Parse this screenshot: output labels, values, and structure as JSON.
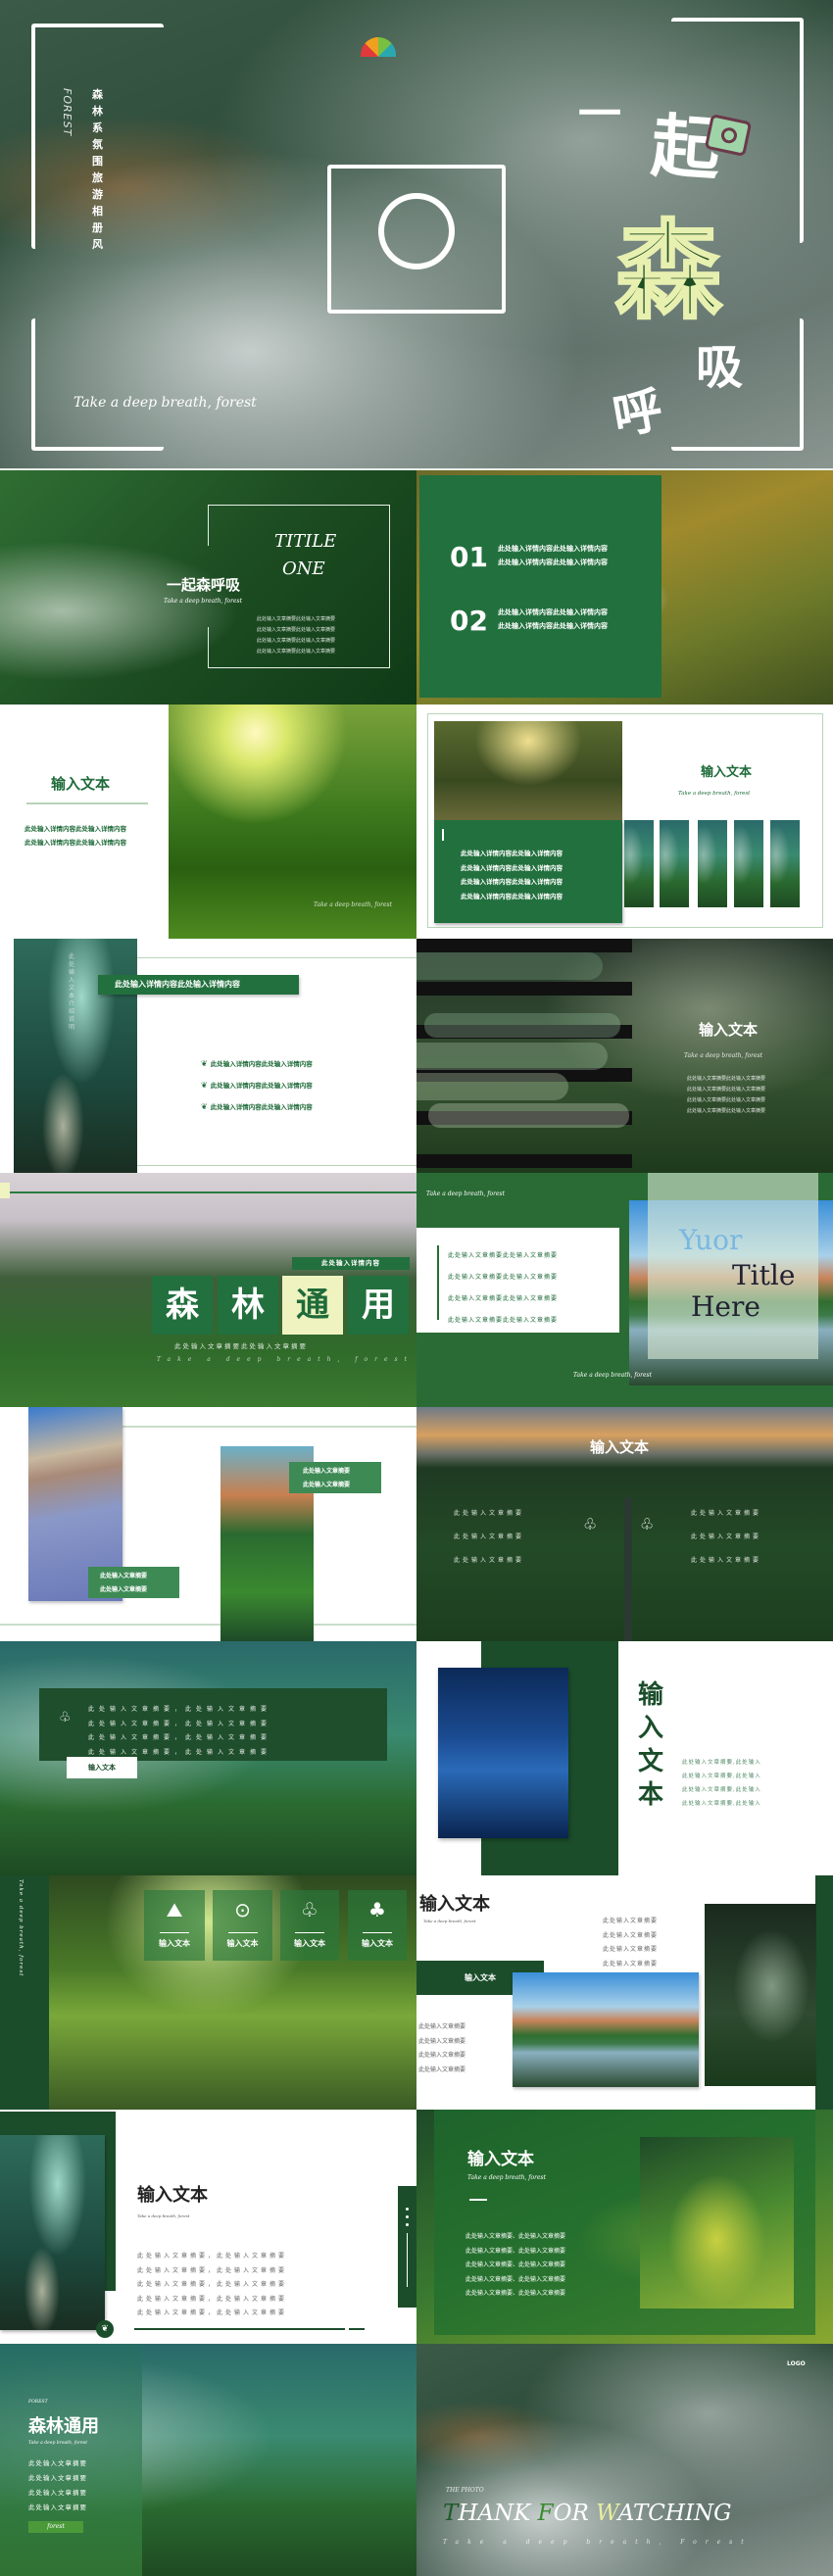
{
  "colors": {
    "primary_green": "#1f6b3a",
    "dark_green": "#1b4d2a",
    "pale_yellow": "#eef3c0",
    "white": "#ffffff"
  },
  "s1": {
    "vertical_title": "森林系氛围旅游相册风",
    "vertical_en": "FOREST",
    "tagline": "Take a deep breath, forest",
    "title_chars": [
      "一",
      "起",
      "森",
      "吸",
      "呼"
    ],
    "icons": [
      "camera-icon",
      "focus-frame-icon",
      "logo-icon"
    ]
  },
  "s2": {
    "title1": "TITILE",
    "title2": "ONE",
    "heading": "一起森呼吸",
    "tagline": "Take a deep breath, forest",
    "lines": [
      "此处输入文章摘要此处输入文章摘要",
      "此处输入文章摘要此处输入文章摘要",
      "此处输入文章摘要此处输入文章摘要",
      "此处输入文章摘要此处输入文章摘要"
    ]
  },
  "s3": {
    "items": [
      {
        "num": "01",
        "lines": [
          "此处输入详情内容此处输入详情内容",
          "此处输入详情内容此处输入详情内容"
        ]
      },
      {
        "num": "02",
        "lines": [
          "此处输入详情内容此处输入详情内容",
          "此处输入详情内容此处输入详情内容"
        ]
      }
    ]
  },
  "s4": {
    "title": "输入文本",
    "lines": [
      "此处输入详情内容此处输入详情内容",
      "此处输入详情内容此处输入详情内容"
    ],
    "tagline": "Take a deep breath, forest"
  },
  "s5": {
    "title": "输入文本",
    "tagline": "Take a deep breath, forest",
    "lines": [
      "此处输入详情内容此处输入详情内容",
      "此处输入详情内容此处输入详情内容",
      "此处输入详情内容此处输入详情内容",
      "此处输入详情内容此处输入详情内容"
    ]
  },
  "s6": {
    "header": "此处输入详情内容此处输入详情内容",
    "vertical": "此处输入文本介绍说明",
    "items": [
      "此处输入详情内容此处输入详情内容",
      "此处输入详情内容此处输入详情内容",
      "此处输入详情内容此处输入详情内容"
    ]
  },
  "s7": {
    "title": "输入文本",
    "tagline": "Take a deep breath, forest",
    "lines": [
      "此处输入文章摘要此处输入文章摘要",
      "此处输入文章摘要此处输入文章摘要",
      "此处输入文章摘要此处输入文章摘要",
      "此处输入文章摘要此处输入文章摘要"
    ]
  },
  "s8": {
    "header": "此处输入详情内容",
    "chars": [
      "森",
      "林",
      "通",
      "用"
    ],
    "subtitle": "此处输入文章摘要此处输入文章摘要",
    "tagline": "Take a deep breath, forest"
  },
  "s9": {
    "tagline_top": "Take a deep breath, forest",
    "lines": [
      "此处输入文章摘要此处输入文章摘要",
      "此处输入文章摘要此处输入文章摘要",
      "此处输入文章摘要此处输入文章摘要",
      "此处输入文章摘要此处输入文章摘要"
    ],
    "word1": "Yuor",
    "word2": "Title",
    "word3": "Here",
    "tagline_bottom": "Take a deep breath, forest"
  },
  "s10": {
    "box1": [
      "此处输入文章摘要",
      "此处输入文章摘要"
    ],
    "box2": [
      "此处输入文章摘要",
      "此处输入文章摘要"
    ]
  },
  "s11": {
    "title": "输入文本",
    "left": [
      "此处输入文章摘要",
      "此处输入文章摘要",
      "此处输入文章摘要"
    ],
    "right": [
      "此处输入文章摘要",
      "此处输入文章摘要",
      "此处输入文章摘要"
    ]
  },
  "s12": {
    "lines": [
      "此处输入文章摘要，此处输入文章摘要",
      "此处输入文章摘要，此处输入文章摘要",
      "此处输入文章摘要，此处输入文章摘要",
      "此处输入文章摘要，此处输入文章摘要"
    ],
    "button": "输入文本"
  },
  "s13": {
    "title": "输入文本",
    "lines": [
      "此处输入文章摘要,此处输入",
      "此处输入文章摘要,此处输入",
      "此处输入文章摘要,此处输入",
      "此处输入文章摘要,此处输入"
    ]
  },
  "s14": {
    "vertical": "Take a deep breath, forest",
    "cards": [
      {
        "label": "输入文本",
        "icon": "mountain-icon"
      },
      {
        "label": "输入文本",
        "icon": "location-pin-icon"
      },
      {
        "label": "输入文本",
        "icon": "trees-icon"
      },
      {
        "label": "输入文本",
        "icon": "forest-icon"
      }
    ]
  },
  "s15": {
    "title": "输入文本",
    "tagline": "Take a deep breath, forest",
    "right_lines": [
      "此处输入文章摘要",
      "此处输入文章摘要",
      "此处输入文章摘要",
      "此处输入文章摘要"
    ],
    "box": "输入文本",
    "left_lines": [
      "此处输入文章摘要",
      "此处输入文章摘要",
      "此处输入文章摘要",
      "此处输入文章摘要"
    ]
  },
  "s16": {
    "title": "输入文本",
    "tagline": "Take a deep breath, forest",
    "lines": [
      "此处输入文章摘要，此处输入文章摘要",
      "此处输入文章摘要，此处输入文章摘要",
      "此处输入文章摘要，此处输入文章摘要",
      "此处输入文章摘要，此处输入文章摘要",
      "此处输入文章摘要，此处输入文章摘要"
    ]
  },
  "s17": {
    "title": "输入文本",
    "tagline": "Take a deep breath, forest",
    "lines": [
      "此处输入文章摘要、此处输入文章摘要",
      "此处输入文章摘要、此处输入文章摘要",
      "此处输入文章摘要、此处输入文章摘要",
      "此处输入文章摘要、此处输入文章摘要",
      "此处输入文章摘要、此处输入文章摘要"
    ]
  },
  "s18": {
    "label": "FOREST",
    "title": "森林通用",
    "tagline": "Take a deep breath, forest",
    "lines": [
      "此处输入文章摘要",
      "此处输入文章摘要",
      "此处输入文章摘要",
      "此处输入文章摘要"
    ],
    "button": "forest"
  },
  "s19": {
    "logo": "LOGO",
    "kicker": "THE PHOTO",
    "thank_t": "T",
    "thank_1": "HANK ",
    "thank_f": "F",
    "thank_2": "OR ",
    "thank_w": "W",
    "thank_3": "ATCHING",
    "tagline": "Take a deep breath, Forest"
  }
}
